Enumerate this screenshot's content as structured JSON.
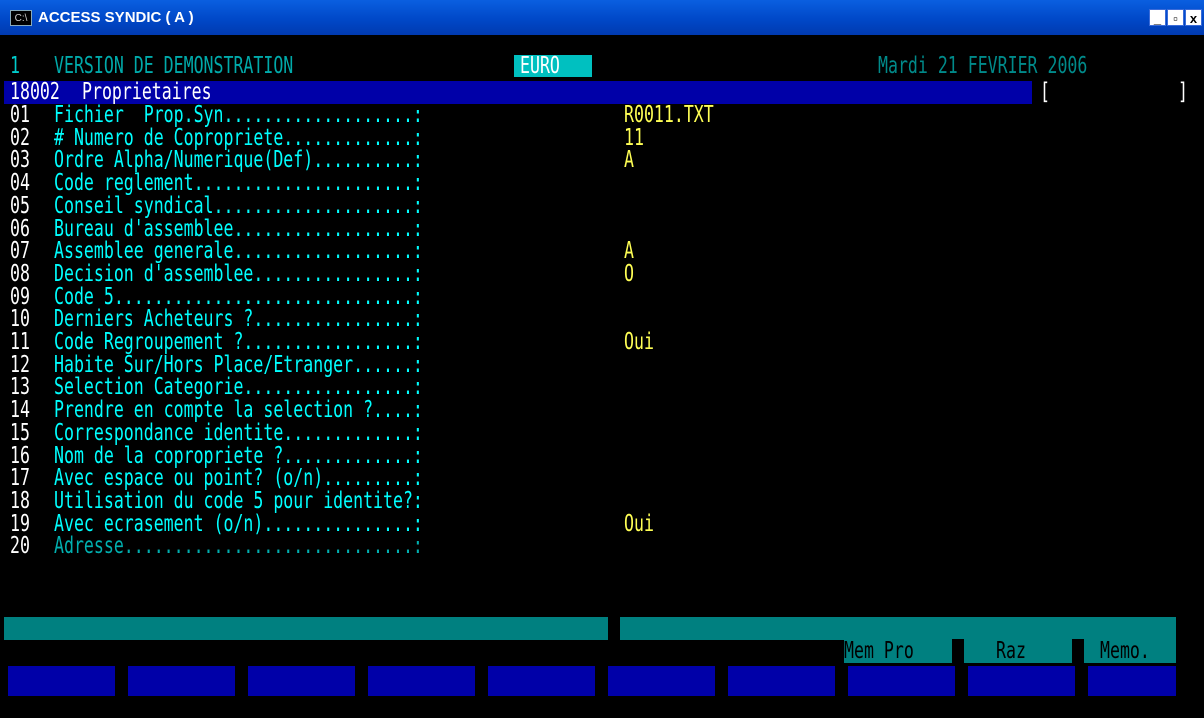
{
  "window": {
    "title": "ACCESS SYNDIC ( A )",
    "sys_icon": "C:\\",
    "buttons": {
      "minimize": "_",
      "maximize": "▫",
      "close": "x"
    }
  },
  "status_line": {
    "index": "1",
    "version": "VERSION DE DEMONSTRATION",
    "currency": "EURO",
    "date": "Mardi 21 FEVRIER 2006"
  },
  "screen": {
    "code": "18002",
    "name": "Proprietaires",
    "bracket_open": "[",
    "bracket_close": "]"
  },
  "fields": [
    {
      "num": "01",
      "label": "Fichier  Prop.Syn...................:",
      "value": "R0011.TXT"
    },
    {
      "num": "02",
      "label": "# Numero de Copropriete.............:",
      "value": "11"
    },
    {
      "num": "03",
      "label": "Ordre Alpha/Numerique(Def)..........:",
      "value": "A"
    },
    {
      "num": "04",
      "label": "Code reglement......................:",
      "value": ""
    },
    {
      "num": "05",
      "label": "Conseil syndical....................:",
      "value": ""
    },
    {
      "num": "06",
      "label": "Bureau d'assemblee..................:",
      "value": ""
    },
    {
      "num": "07",
      "label": "Assemblee generale..................:",
      "value": "A"
    },
    {
      "num": "08",
      "label": "Decision d'assemblee................:",
      "value": "O"
    },
    {
      "num": "09",
      "label": "Code 5..............................:",
      "value": ""
    },
    {
      "num": "10",
      "label": "Derniers Acheteurs ?................:",
      "value": ""
    },
    {
      "num": "11",
      "label": "Code Regroupement ?.................:",
      "value": "Oui"
    },
    {
      "num": "12",
      "label": "Habite Sur/Hors Place/Etranger......:",
      "value": ""
    },
    {
      "num": "13",
      "label": "Selection Categorie.................:",
      "value": ""
    },
    {
      "num": "14",
      "label": "Prendre en compte la selection ?....:",
      "value": ""
    },
    {
      "num": "15",
      "label": "Correspondance identite.............:",
      "value": ""
    },
    {
      "num": "16",
      "label": "Nom de la copropriete ?.............:",
      "value": ""
    },
    {
      "num": "17",
      "label": "Avec espace ou point? (o/n).........:",
      "value": ""
    },
    {
      "num": "18",
      "label": "Utilisation du code 5 pour identite?:",
      "value": ""
    },
    {
      "num": "19",
      "label": "Avec ecrasement (o/n)...............:",
      "value": "Oui"
    },
    {
      "num": "20",
      "label": "Adresse.............................:",
      "value": ""
    }
  ],
  "function_keys": {
    "labels": [
      "Mem Pro",
      "Raz",
      "Memo."
    ]
  },
  "colors": {
    "background": "#000000",
    "label": "#00ffff",
    "value": "#ffff55",
    "highlight_bar": "#0000a8",
    "active_field": "#008080",
    "titlebar": "#0048c8"
  }
}
